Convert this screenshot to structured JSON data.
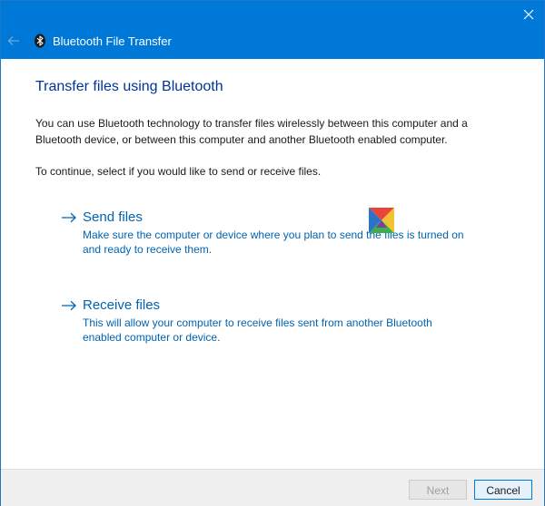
{
  "window": {
    "title": "Bluetooth File Transfer",
    "accent_color": "#0078d7",
    "link_color": "#0063b1",
    "heading_color": "#003399"
  },
  "icons": {
    "close": "close-icon",
    "back": "back-arrow-icon",
    "app": "bluetooth-icon",
    "option_arrow": "arrow-right-icon",
    "logo": "colorful-logo-icon"
  },
  "main": {
    "heading": "Transfer files using Bluetooth",
    "description_line1": "You can use Bluetooth technology to transfer files wirelessly between this computer and a",
    "description_line2": "Bluetooth device, or between this computer and another Bluetooth enabled computer.",
    "prompt": "To continue, select if you would like to send or receive files."
  },
  "options": [
    {
      "title": "Send files",
      "desc_line1": "Make sure the computer or device where you plan to send the files is turned on",
      "desc_line2": "and ready to receive them."
    },
    {
      "title": "Receive files",
      "desc_line1": "This will allow your computer to receive files sent from another Bluetooth",
      "desc_line2": "enabled computer or device."
    }
  ],
  "footer": {
    "next_label": "Next",
    "cancel_label": "Cancel"
  }
}
